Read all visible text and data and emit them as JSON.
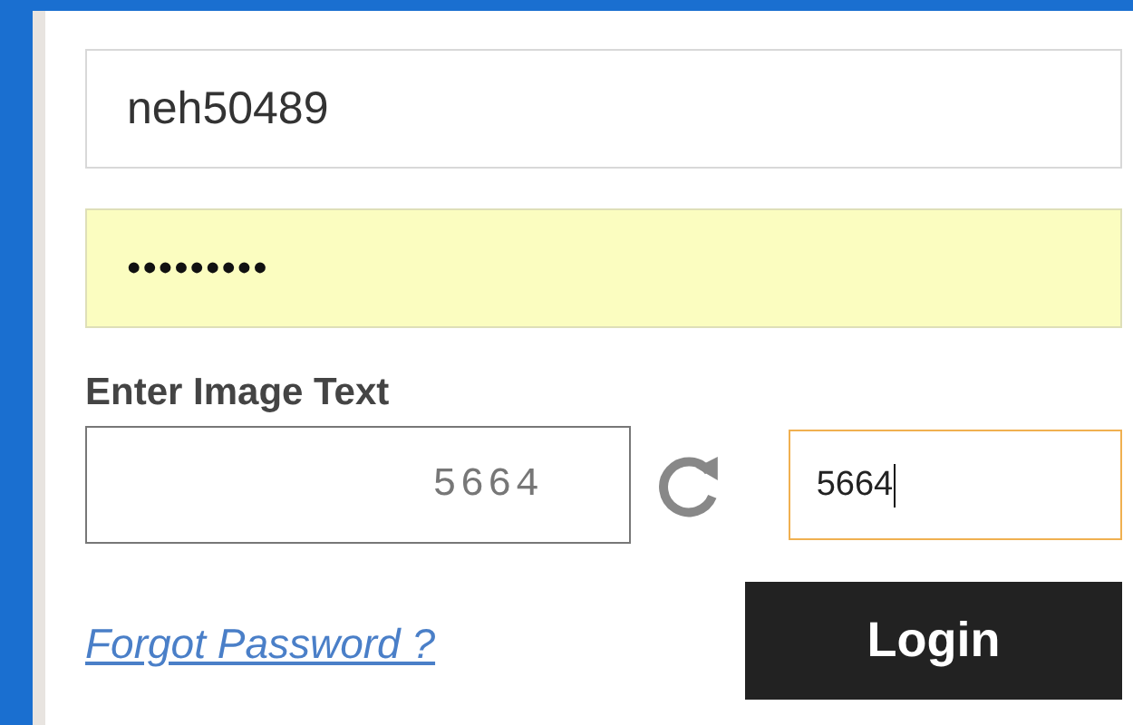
{
  "username_field": {
    "value": "neh50489",
    "autofilled": false
  },
  "password_field": {
    "value": "•••••••••",
    "autofilled": true
  },
  "captcha": {
    "label": "Enter Image Text",
    "image_text": "5664",
    "answer": {
      "value": "5664",
      "focused": true
    }
  },
  "forgot_link": "Forgot Password ?",
  "login_button": "Login"
}
